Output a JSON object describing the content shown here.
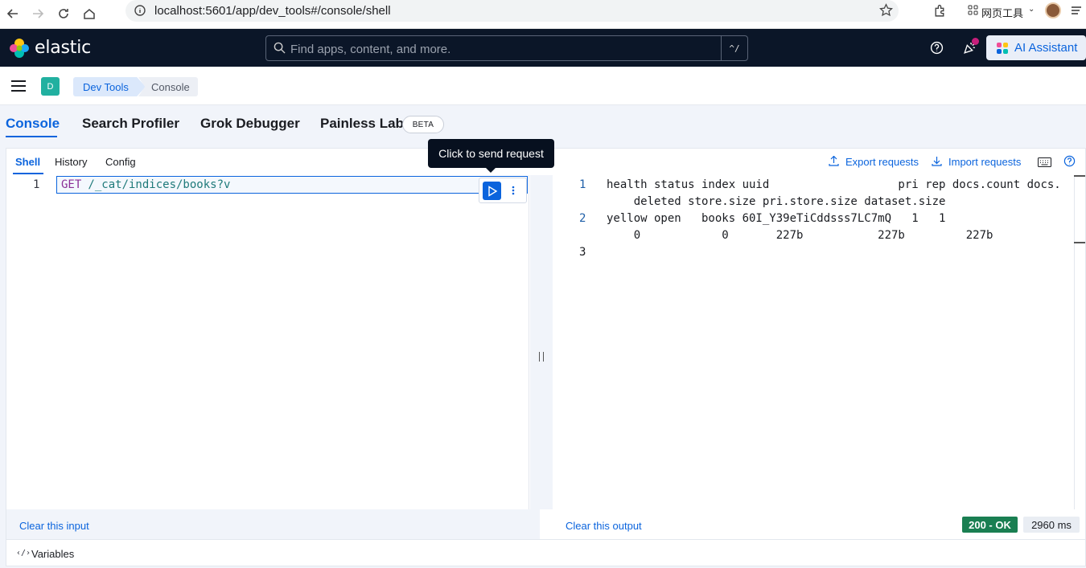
{
  "browser": {
    "url": "localhost:5601/app/dev_tools#/console/shell",
    "menu_label": "网页工具"
  },
  "header": {
    "logo": "elastic",
    "search_placeholder": "Find apps, content, and more.",
    "search_shortcut": "^/",
    "ai_assistant_label": "AI Assistant"
  },
  "breadcrumb": {
    "space_initial": "D",
    "items": [
      "Dev Tools",
      "Console"
    ]
  },
  "tabs": {
    "console": "Console",
    "search_profiler": "Search Profiler",
    "grok_debugger": "Grok Debugger",
    "painless_lab": "Painless Lab",
    "beta": "BETA"
  },
  "subtabs": {
    "shell": "Shell",
    "history": "History",
    "config": "Config"
  },
  "tooltip": "Click to send request",
  "editor": {
    "line_number": "1",
    "method": "GET",
    "path": " /_cat/indices/books?v"
  },
  "toolbar": {
    "export": "Export requests",
    "import": "Import requests"
  },
  "output": {
    "lines": [
      {
        "num": "1",
        "text": "health status index uuid                   pri rep docs.count docs."
      },
      {
        "num": "",
        "text": "    deleted store.size pri.store.size dataset.size"
      },
      {
        "num": "2",
        "text": "yellow open   books 60I_Y39eTiCddsss7LC7mQ   1   1"
      },
      {
        "num": "",
        "text": "    0            0       227b           227b         227b"
      },
      {
        "num": "3",
        "text": ""
      }
    ]
  },
  "footer": {
    "clear_input": "Clear this input",
    "clear_output": "Clear this output",
    "status": "200 - OK",
    "duration": "2960 ms",
    "variables": "Variables"
  },
  "colors": {
    "header_bg": "#0b1628",
    "accent": "#0b64dd",
    "status_ok": "#1a7f52",
    "method_color": "#8b2f97",
    "path_color": "#1f7a7a"
  }
}
